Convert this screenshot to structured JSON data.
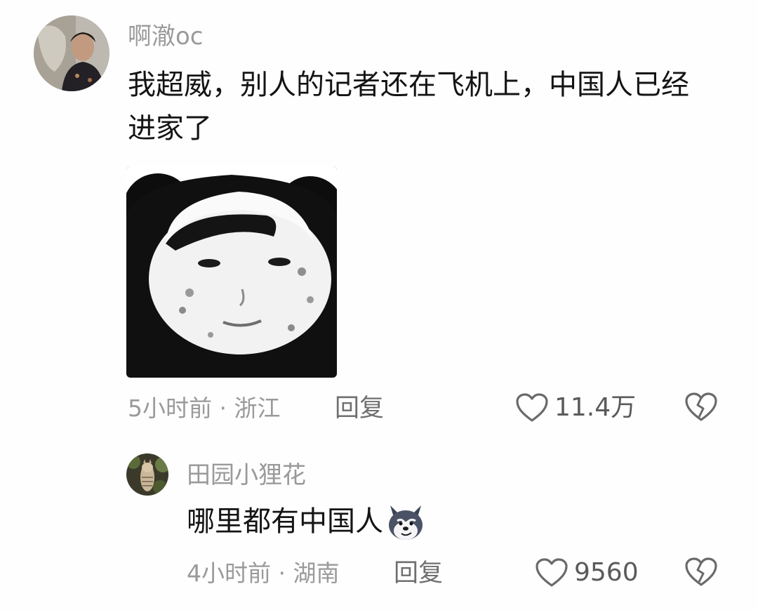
{
  "comments": [
    {
      "username": "啊澈oc",
      "text": "我超威，别人的记者还在飞机上，中国人已经进家了",
      "time": "5小时前",
      "location": "浙江",
      "meta_sep": " · ",
      "reply_label": "回复",
      "like_count": "11.4万",
      "sticker_icon": "meme-face-sticker"
    },
    {
      "username": "田园小狸花",
      "text": "哪里都有中国人",
      "emoji_icon": "husky-dog-emoji",
      "time": "4小时前",
      "location": "湖南",
      "meta_sep": " · ",
      "reply_label": "回复",
      "like_count": "9560"
    }
  ]
}
